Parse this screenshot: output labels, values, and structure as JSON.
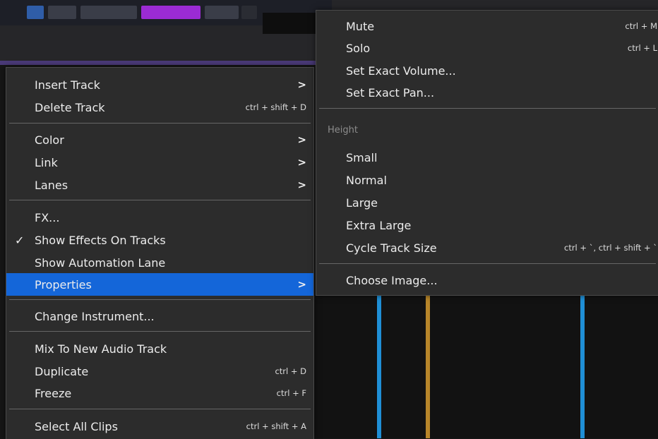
{
  "colors": {
    "menu_bg": "#2c2c2c",
    "highlight": "#1466d9",
    "divider": "#666666",
    "text": "#ececec",
    "muted_text": "#8c8c8c"
  },
  "main_menu": {
    "items": [
      {
        "label": "Insert Track",
        "shortcut": "",
        "submenu": true,
        "checked": false,
        "highlighted": false
      },
      {
        "label": "Delete Track",
        "shortcut": "ctrl + shift + D",
        "submenu": false,
        "checked": false,
        "highlighted": false
      },
      {
        "label": "Color",
        "shortcut": "",
        "submenu": true,
        "checked": false,
        "highlighted": false
      },
      {
        "label": "Link",
        "shortcut": "",
        "submenu": true,
        "checked": false,
        "highlighted": false
      },
      {
        "label": "Lanes",
        "shortcut": "",
        "submenu": true,
        "checked": false,
        "highlighted": false
      },
      {
        "label": "FX...",
        "shortcut": "",
        "submenu": false,
        "checked": false,
        "highlighted": false
      },
      {
        "label": "Show Effects On Tracks",
        "shortcut": "",
        "submenu": false,
        "checked": true,
        "highlighted": false
      },
      {
        "label": "Show Automation Lane",
        "shortcut": "",
        "submenu": false,
        "checked": false,
        "highlighted": false
      },
      {
        "label": "Properties",
        "shortcut": "",
        "submenu": true,
        "checked": false,
        "highlighted": true
      },
      {
        "label": "Change Instrument...",
        "shortcut": "",
        "submenu": false,
        "checked": false,
        "highlighted": false
      },
      {
        "label": "Mix To New Audio Track",
        "shortcut": "",
        "submenu": false,
        "checked": false,
        "highlighted": false
      },
      {
        "label": "Duplicate",
        "shortcut": "ctrl + D",
        "submenu": false,
        "checked": false,
        "highlighted": false
      },
      {
        "label": "Freeze",
        "shortcut": "ctrl + F",
        "submenu": false,
        "checked": false,
        "highlighted": false
      },
      {
        "label": "Select All Clips",
        "shortcut": "ctrl + shift + A",
        "submenu": false,
        "checked": false,
        "highlighted": false
      }
    ],
    "check_glyph": "✓",
    "arrow_glyph": ">"
  },
  "sub_menu": {
    "items": [
      {
        "label": "Mute",
        "shortcut": "ctrl + M"
      },
      {
        "label": "Solo",
        "shortcut": "ctrl + L"
      },
      {
        "label": "Set Exact Volume...",
        "shortcut": ""
      },
      {
        "label": "Set Exact Pan...",
        "shortcut": ""
      },
      {
        "label": "Small",
        "shortcut": ""
      },
      {
        "label": "Normal",
        "shortcut": ""
      },
      {
        "label": "Large",
        "shortcut": ""
      },
      {
        "label": "Extra Large",
        "shortcut": ""
      },
      {
        "label": "Cycle Track Size",
        "shortcut": "ctrl + `, ctrl + shift + `"
      },
      {
        "label": "Choose Image...",
        "shortcut": ""
      }
    ],
    "height_header": "Height"
  }
}
